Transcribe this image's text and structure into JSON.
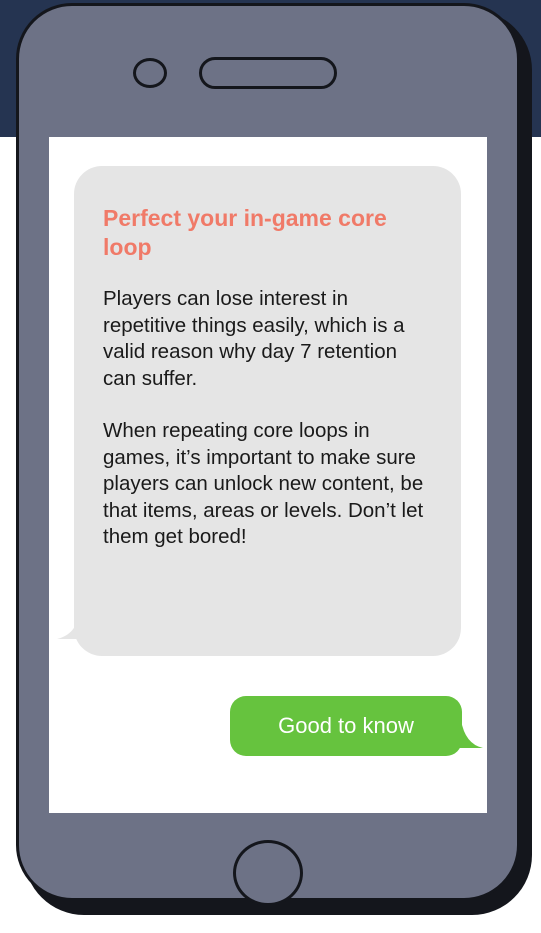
{
  "colors": {
    "background_band": "#253451",
    "phone_body": "#6d7286",
    "phone_outline": "#14161c",
    "screen": "#ffffff",
    "incoming_bubble": "#e5e5e5",
    "outgoing_bubble": "#66c33e",
    "title_accent": "#f07a68"
  },
  "message_in": {
    "title": "Perfect your in-game core loop",
    "paragraph_1": "Players can lose interest in repetitive things easily, which is a valid reason why day 7 retention can suffer.",
    "paragraph_2": "When repeating core loops in games, it’s important to make sure players can unlock new content, be that items, areas or levels. Don’t let them get bored!"
  },
  "message_out": {
    "text": "Good to know"
  }
}
